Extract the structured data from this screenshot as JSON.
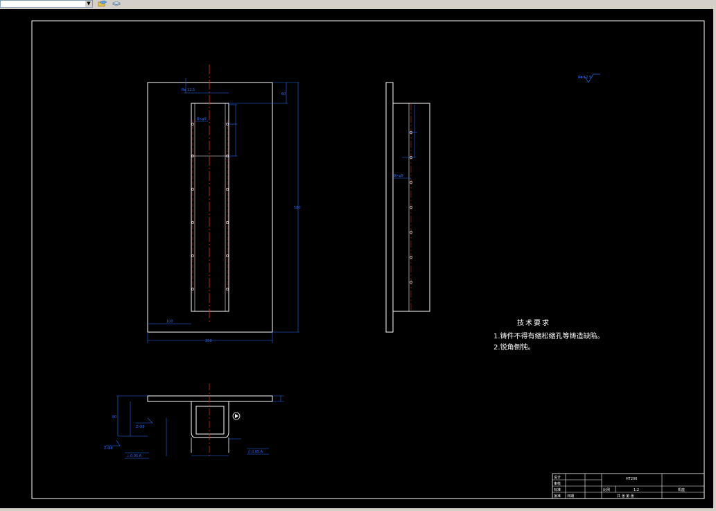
{
  "toolbar": {
    "layer_combo_value": "",
    "icons": [
      "layer-state-icon",
      "layer-stack-icon"
    ]
  },
  "colors": {
    "background": "#000000",
    "outline": "#ffffff",
    "dimension": "#2a6cff",
    "centerline": "#d21e1e"
  },
  "drawing": {
    "tech_requirements": {
      "title": "技术要求",
      "item1": "1.铸件不得有缩松缩孔等铸造缺陷。",
      "item2": "2.锐角倒钝。"
    },
    "dims": {
      "front_width": "350",
      "front_height": "580",
      "left_offset": "100",
      "top_offset": "60",
      "hole_a": "8×φ9",
      "hole_b": "8×φ9",
      "roughness": "Ra 12.5",
      "section_height": "80",
      "section_dim_a": "Z-Ф8",
      "section_dim_b": "Z-Ф8",
      "section_tol_a": "⊥ 0.05 A",
      "section_tol_b": "// 0.05 A"
    },
    "title_block": {
      "material": "HT200",
      "scale_label": "比例",
      "scale": "1:2",
      "name": "机座",
      "row_labels": [
        "设计",
        "审核",
        "标准",
        "批准"
      ],
      "signature": "日期",
      "sheet": "共 张 第 张"
    }
  }
}
